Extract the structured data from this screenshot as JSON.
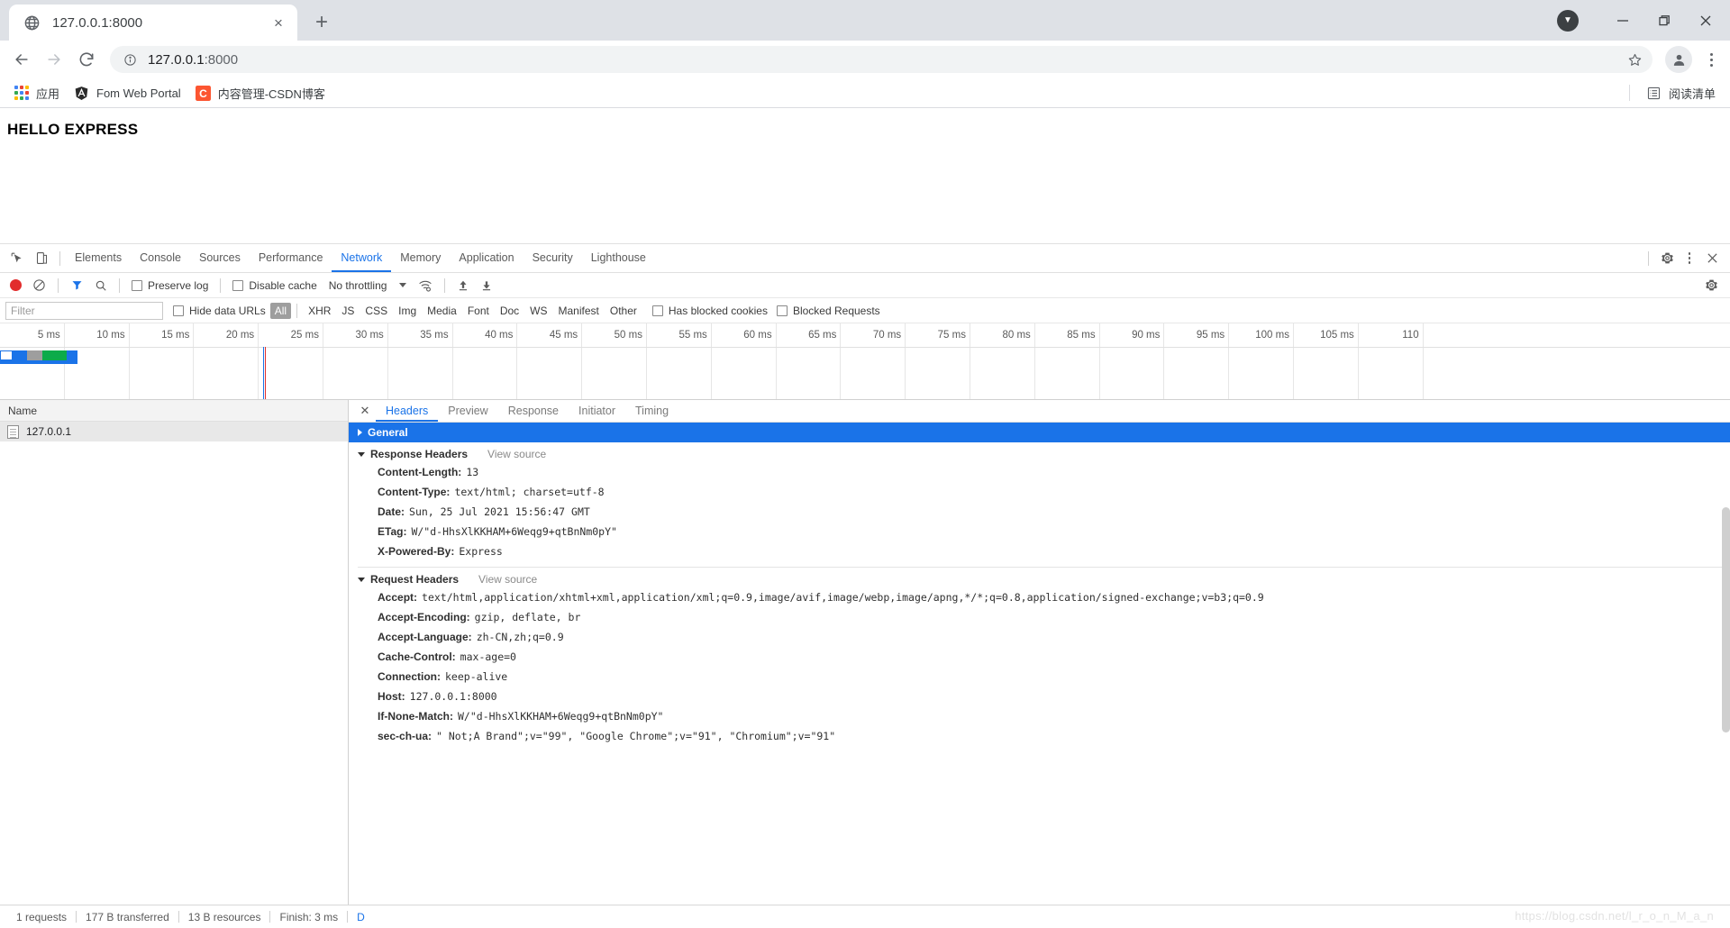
{
  "browser": {
    "tab": {
      "title": "127.0.0.1:8000",
      "favicon": "globe-icon",
      "close": "×"
    },
    "new_tab": "+",
    "window": {
      "minimize": "—",
      "maximize": "❐",
      "close": "✕",
      "update_badge": "▼"
    },
    "nav": {
      "back": "←",
      "forward": "→",
      "reload": "↻"
    },
    "omnibox": {
      "info_icon": "info-circle-icon",
      "host": "127.0.0.1",
      "port": ":8000",
      "star": "☆"
    },
    "bookmarks": [
      {
        "label": "应用",
        "icon": "apps-grid-icon"
      },
      {
        "label": "Fom Web Portal",
        "icon": "angular-icon"
      },
      {
        "label": "内容管理-CSDN博客",
        "icon": "csdn-icon"
      }
    ],
    "reading_list": {
      "label": "阅读清单",
      "icon": "reading-list-icon"
    }
  },
  "page": {
    "heading": "HELLO EXPRESS"
  },
  "devtools": {
    "panel_tabs": [
      "Elements",
      "Console",
      "Sources",
      "Performance",
      "Network",
      "Memory",
      "Application",
      "Security",
      "Lighthouse"
    ],
    "active_panel": "Network",
    "left_icons": [
      "inspect-element-icon",
      "device-toolbar-icon"
    ],
    "right_icons": [
      "settings-gear-icon",
      "more-options-icon",
      "close-devtools-icon"
    ],
    "controls": {
      "record": "record-button",
      "clear": "clear-button",
      "filter_icon": "filter-icon",
      "search_icon": "search-icon",
      "preserve_log": "Preserve log",
      "disable_cache": "Disable cache",
      "throttling": "No throttling",
      "wifi_icon": "network-conditions-icon",
      "import_icon": "import-har-icon",
      "export_icon": "export-har-icon",
      "settings_icon": "network-settings-icon"
    },
    "filterbar": {
      "placeholder": "Filter",
      "hide_data_urls": "Hide data URLs",
      "types": [
        "All",
        "XHR",
        "JS",
        "CSS",
        "Img",
        "Media",
        "Font",
        "Doc",
        "WS",
        "Manifest",
        "Other"
      ],
      "active_type": "All",
      "has_blocked_cookies": "Has blocked cookies",
      "blocked_requests": "Blocked Requests"
    },
    "overview": {
      "ticks": [
        "5 ms",
        "10 ms",
        "15 ms",
        "20 ms",
        "25 ms",
        "30 ms",
        "35 ms",
        "40 ms",
        "45 ms",
        "50 ms",
        "55 ms",
        "60 ms",
        "65 ms",
        "70 ms",
        "75 ms",
        "80 ms",
        "85 ms",
        "90 ms",
        "95 ms",
        "100 ms",
        "105 ms",
        "110"
      ],
      "event_lines": {
        "dom_content_loaded": "#1a73e8",
        "load": "#e03030"
      }
    },
    "requests": {
      "column_header": "Name",
      "rows": [
        {
          "name": "127.0.0.1",
          "icon": "document-icon"
        }
      ]
    },
    "detail": {
      "tabs": [
        "Headers",
        "Preview",
        "Response",
        "Initiator",
        "Timing"
      ],
      "active_tab": "Headers",
      "close": "✕",
      "sections": [
        {
          "title": "General",
          "collapsed": true,
          "highlight": "#1a73e8",
          "view_source": "",
          "rows": []
        },
        {
          "title": "Response Headers",
          "collapsed": false,
          "view_source": "View source",
          "rows": [
            {
              "key": "Content-Length:",
              "value": "13"
            },
            {
              "key": "Content-Type:",
              "value": "text/html; charset=utf-8"
            },
            {
              "key": "Date:",
              "value": "Sun, 25 Jul 2021 15:56:47 GMT"
            },
            {
              "key": "ETag:",
              "value": "W/\"d-HhsXlKKHAM+6Weqg9+qtBnNm0pY\""
            },
            {
              "key": "X-Powered-By:",
              "value": "Express"
            }
          ]
        },
        {
          "title": "Request Headers",
          "collapsed": false,
          "view_source": "View source",
          "rows": [
            {
              "key": "Accept:",
              "value": "text/html,application/xhtml+xml,application/xml;q=0.9,image/avif,image/webp,image/apng,*/*;q=0.8,application/signed-exchange;v=b3;q=0.9"
            },
            {
              "key": "Accept-Encoding:",
              "value": "gzip, deflate, br"
            },
            {
              "key": "Accept-Language:",
              "value": "zh-CN,zh;q=0.9"
            },
            {
              "key": "Cache-Control:",
              "value": "max-age=0"
            },
            {
              "key": "Connection:",
              "value": "keep-alive"
            },
            {
              "key": "Host:",
              "value": "127.0.0.1:8000"
            },
            {
              "key": "If-None-Match:",
              "value": "W/\"d-HhsXlKKHAM+6Weqg9+qtBnNm0pY\""
            },
            {
              "key": "sec-ch-ua:",
              "value": "\" Not;A Brand\";v=\"99\", \"Google Chrome\";v=\"91\", \"Chromium\";v=\"91\""
            }
          ]
        }
      ]
    },
    "status": {
      "requests": "1 requests",
      "transferred": "177 B transferred",
      "resources": "13 B resources",
      "finish": "Finish: 3 ms",
      "dom_marker": "D"
    }
  },
  "watermark": "https://blog.csdn.net/l_r_o_n_M_a_n"
}
